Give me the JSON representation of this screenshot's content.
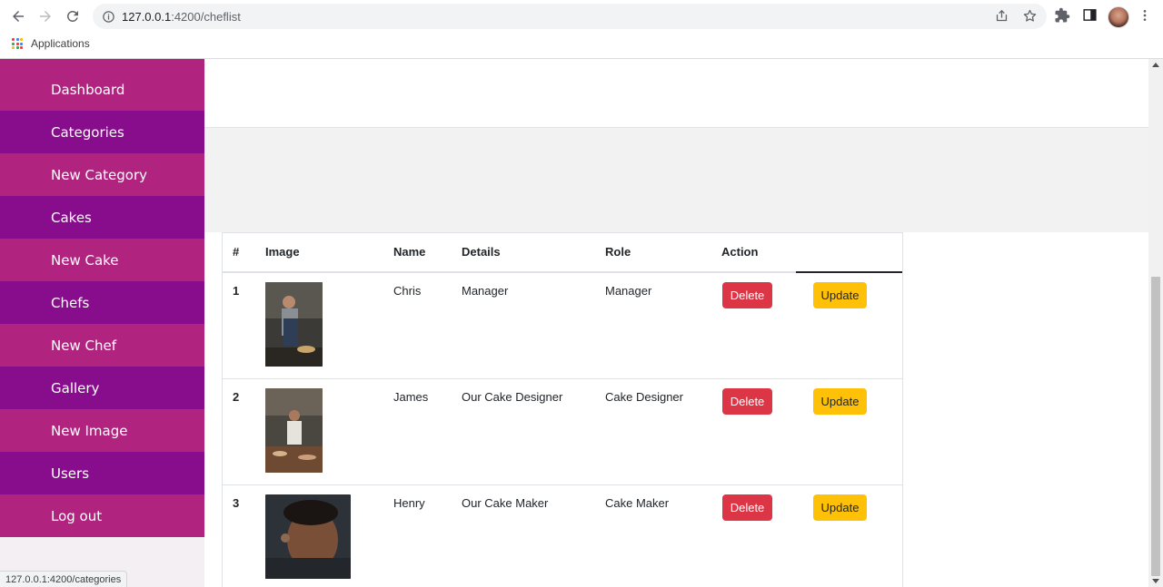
{
  "browser": {
    "url_host": "127.0.0.1",
    "url_path": ":4200/cheflist",
    "bookmark_label": "Applications",
    "status_url": "127.0.0.1:4200/categories"
  },
  "sidebar": {
    "items": [
      {
        "label": "Dashboard"
      },
      {
        "label": "Categories"
      },
      {
        "label": "New Category"
      },
      {
        "label": "Cakes"
      },
      {
        "label": "New Cake"
      },
      {
        "label": "Chefs"
      },
      {
        "label": "New Chef"
      },
      {
        "label": "Gallery"
      },
      {
        "label": "New Image"
      },
      {
        "label": "Users"
      },
      {
        "label": "Log out"
      }
    ]
  },
  "table": {
    "headers": {
      "num": "#",
      "image": "Image",
      "name": "Name",
      "details": "Details",
      "role": "Role",
      "action": "Action"
    },
    "rows": [
      {
        "num": "1",
        "name": "Chris",
        "details": "Manager",
        "role": "Manager",
        "delete": "Delete",
        "update": "Update"
      },
      {
        "num": "2",
        "name": "James",
        "details": "Our Cake Designer",
        "role": "Cake Designer",
        "delete": "Delete",
        "update": "Update"
      },
      {
        "num": "3",
        "name": "Henry",
        "details": "Our Cake Maker",
        "role": "Cake Maker",
        "delete": "Delete",
        "update": "Update"
      }
    ]
  },
  "colors": {
    "sidebar_pink": "#b0237f",
    "sidebar_purple": "#880d8c",
    "delete": "#dc3545",
    "update": "#ffc107"
  }
}
